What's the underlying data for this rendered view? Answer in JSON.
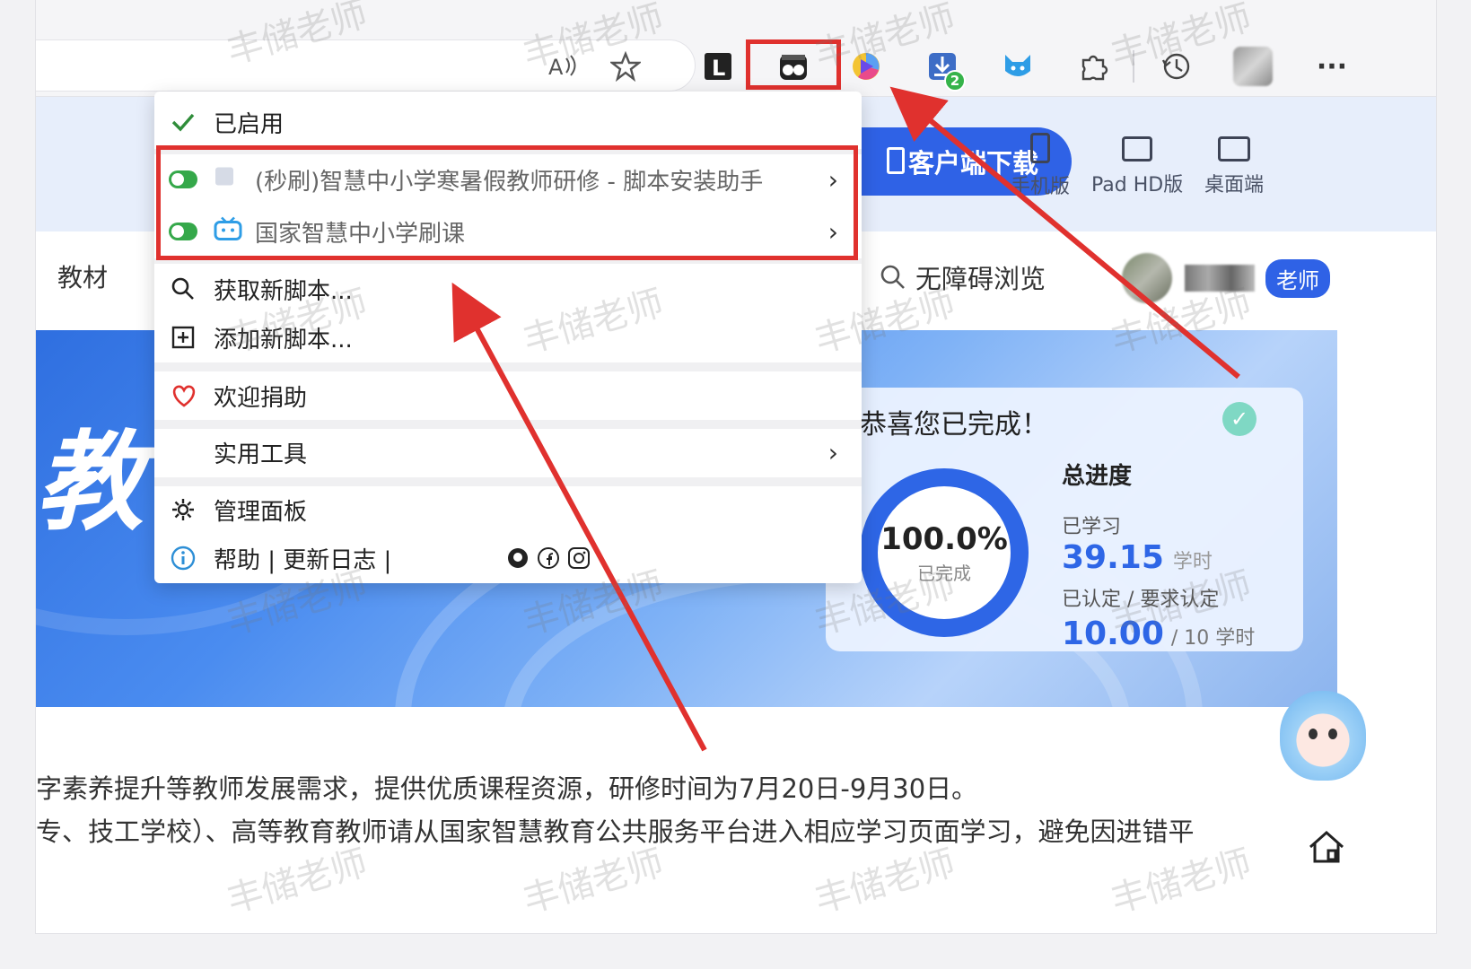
{
  "toolbar": {
    "icons": [
      "read-aloud-icon",
      "favorite-star-icon",
      "l-extension-icon",
      "tampermonkey-icon",
      "color-picker-extension-icon",
      "download-icon",
      "cat-extension-icon",
      "extensions-puzzle-icon",
      "history-icon",
      "profile-avatar-icon",
      "more-options-icon"
    ],
    "download_badge": "2",
    "more_label": "···"
  },
  "menu": {
    "enabled_label": "已启用",
    "scripts": [
      {
        "label": "(秒刷)智慧中小学寒暑假教师研修 - 脚本安装助手"
      },
      {
        "label": "国家智慧中小学刷课"
      }
    ],
    "get_new_scripts": "获取新脚本...",
    "add_new_script": "添加新脚本...",
    "donate": "欢迎捐助",
    "utilities": "实用工具",
    "dashboard": "管理面板",
    "help_changelog": "帮助 | 更新日志 |",
    "arrow": "›"
  },
  "page": {
    "client_download": "客户端下载",
    "devices": [
      {
        "label": "手机版"
      },
      {
        "label": "Pad HD版"
      },
      {
        "label": "桌面端"
      }
    ],
    "nav_left": "教材",
    "accessibility": "无障碍浏览",
    "role_badge": "老师",
    "banner_title": "教",
    "progress": {
      "congrats": "恭喜您已完成！",
      "percent": "100.0%",
      "percent_label": "已完成",
      "title": "总进度",
      "studied_label": "已学习",
      "studied_value": "39.15",
      "studied_unit": "学时",
      "certified_label": "已认定 / 要求认定",
      "certified_value": "10.00",
      "required": "/ 10  学时"
    },
    "content_lines": [
      "字素养提升等教师发展需求，提供优质课程资源，研修时间为7月20日-9月30日。",
      "专、技工学校）、高等教育教师请从国家智慧教育公共服务平台进入相应学习页面学习，避免因进错平"
    ]
  },
  "watermark": "丰储老师",
  "colors": {
    "accent": "#2f62e6",
    "highlight": "#e0312e",
    "toggle_on": "#35a84a"
  }
}
